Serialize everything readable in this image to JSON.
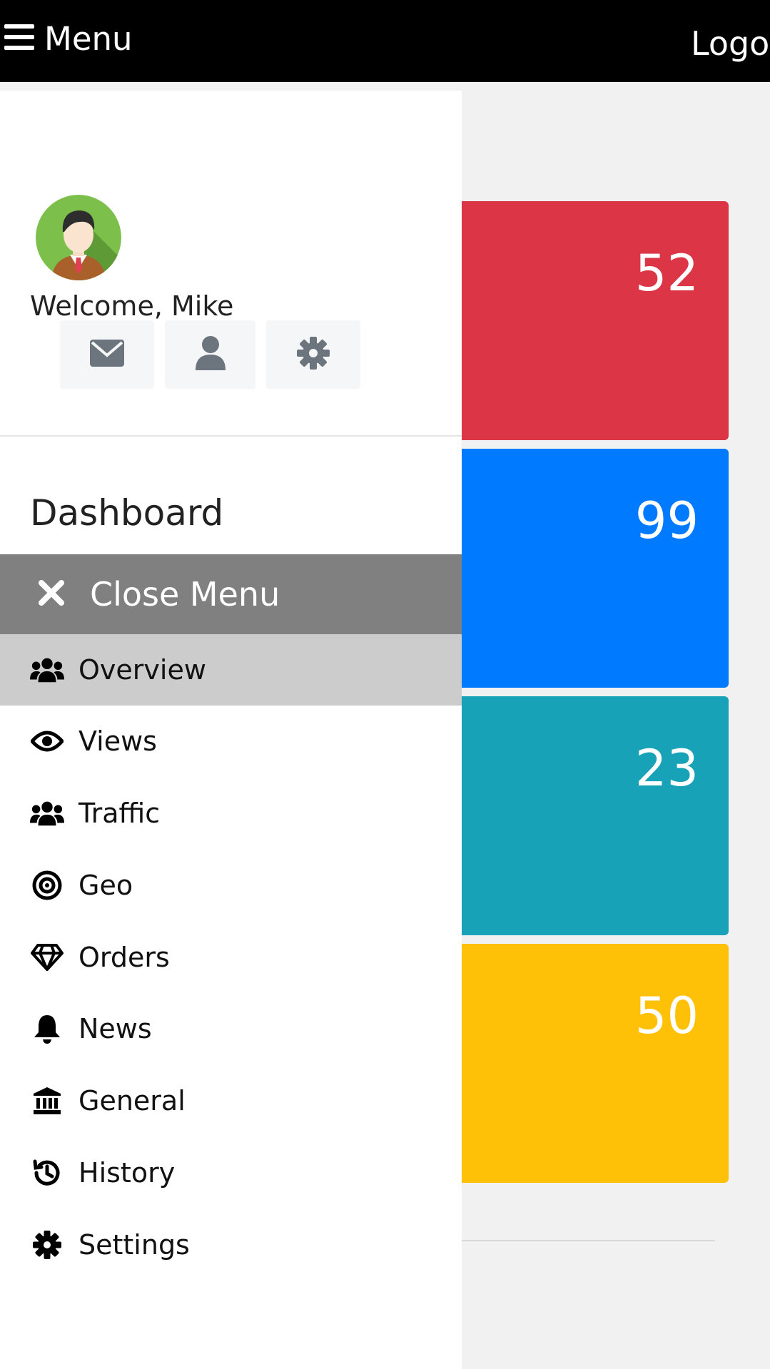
{
  "topbar": {
    "menu_label": "Menu",
    "logo_text": "Logo"
  },
  "cards": [
    {
      "value": "52",
      "color": "#dc3545"
    },
    {
      "value": "99",
      "color": "#007bff"
    },
    {
      "value": "23",
      "color": "#17a2b8"
    },
    {
      "value": "50",
      "color": "#ffc107"
    }
  ],
  "sidebar": {
    "welcome": "Welcome, Mike",
    "quick_actions": [
      {
        "icon": "envelope-icon"
      },
      {
        "icon": "user-icon"
      },
      {
        "icon": "gear-icon"
      }
    ],
    "heading": "Dashboard",
    "close_label": "Close Menu",
    "items": [
      {
        "label": "Overview",
        "icon": "users-icon",
        "active": true
      },
      {
        "label": "Views",
        "icon": "eye-icon"
      },
      {
        "label": "Traffic",
        "icon": "users-icon"
      },
      {
        "label": "Geo",
        "icon": "bullseye-icon"
      },
      {
        "label": "Orders",
        "icon": "diamond-icon"
      },
      {
        "label": "News",
        "icon": "bell-icon"
      },
      {
        "label": "General",
        "icon": "bank-icon"
      },
      {
        "label": "History",
        "icon": "history-icon"
      },
      {
        "label": "Settings",
        "icon": "cog-icon"
      }
    ]
  }
}
